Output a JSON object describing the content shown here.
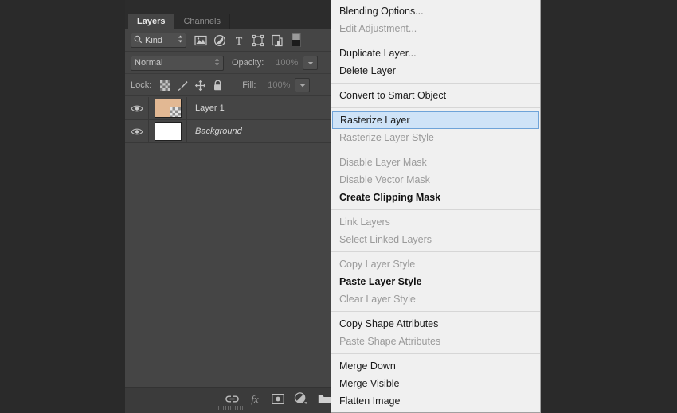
{
  "panel": {
    "tabs": [
      {
        "label": "Layers",
        "active": true
      },
      {
        "label": "Channels",
        "active": false
      }
    ],
    "filter": {
      "search_icon": "magnifier-icon",
      "kind_label": "Kind",
      "stepper_icon": "updown-stepper-icon",
      "icons": [
        "pixel-layer-filter-icon",
        "adjustment-layer-filter-icon",
        "type-layer-filter-icon",
        "shape-layer-filter-icon",
        "smart-object-filter-icon",
        "filter-toggle-switch-icon"
      ]
    },
    "blend": {
      "mode": "Normal",
      "opacity_label": "Opacity:",
      "opacity_value": "100%"
    },
    "lock": {
      "label": "Lock:",
      "icons": [
        "lock-transparent-pixels-icon",
        "lock-image-pixels-icon",
        "lock-position-icon",
        "lock-all-icon"
      ],
      "fill_label": "Fill:",
      "fill_value": "100%"
    },
    "layers": [
      {
        "name": "Layer 1",
        "visible": true,
        "italic": false,
        "thumb": "tan-with-transparency"
      },
      {
        "name": "Background",
        "visible": true,
        "italic": true,
        "thumb": "white"
      }
    ],
    "bottom_icons": [
      "link-layers-icon",
      "add-layer-style-fx-icon",
      "add-layer-mask-icon",
      "new-fill-adjustment-layer-icon",
      "new-group-folder-icon"
    ]
  },
  "context_menu": {
    "groups": [
      {
        "items": [
          {
            "label": "Blending Options...",
            "state": "enabled"
          },
          {
            "label": "Edit Adjustment...",
            "state": "disabled"
          }
        ]
      },
      {
        "items": [
          {
            "label": "Duplicate Layer...",
            "state": "enabled"
          },
          {
            "label": "Delete Layer",
            "state": "enabled"
          }
        ]
      },
      {
        "items": [
          {
            "label": "Convert to Smart Object",
            "state": "enabled"
          }
        ]
      },
      {
        "items": [
          {
            "label": "Rasterize Layer",
            "state": "highlighted"
          },
          {
            "label": "Rasterize Layer Style",
            "state": "disabled"
          }
        ]
      },
      {
        "items": [
          {
            "label": "Disable Layer Mask",
            "state": "disabled"
          },
          {
            "label": "Disable Vector Mask",
            "state": "disabled"
          },
          {
            "label": "Create Clipping Mask",
            "state": "bold"
          }
        ]
      },
      {
        "items": [
          {
            "label": "Link Layers",
            "state": "disabled"
          },
          {
            "label": "Select Linked Layers",
            "state": "disabled"
          }
        ]
      },
      {
        "items": [
          {
            "label": "Copy Layer Style",
            "state": "disabled"
          },
          {
            "label": "Paste Layer Style",
            "state": "bold"
          },
          {
            "label": "Clear Layer Style",
            "state": "disabled"
          }
        ]
      },
      {
        "items": [
          {
            "label": "Copy Shape Attributes",
            "state": "enabled"
          },
          {
            "label": "Paste Shape Attributes",
            "state": "disabled"
          }
        ]
      },
      {
        "items": [
          {
            "label": "Merge Down",
            "state": "enabled"
          },
          {
            "label": "Merge Visible",
            "state": "enabled"
          },
          {
            "label": "Flatten Image",
            "state": "enabled"
          }
        ]
      }
    ]
  },
  "colors": {
    "workspace_bg": "#2a2a2a",
    "panel_bg": "#454545",
    "panel_header_bg": "#2c2c2c",
    "menu_bg": "#f0f0f0",
    "menu_highlight_bg": "#cfe3f7",
    "menu_highlight_border": "#6fa3d8",
    "layer_thumb_tan": "#e2b893"
  }
}
